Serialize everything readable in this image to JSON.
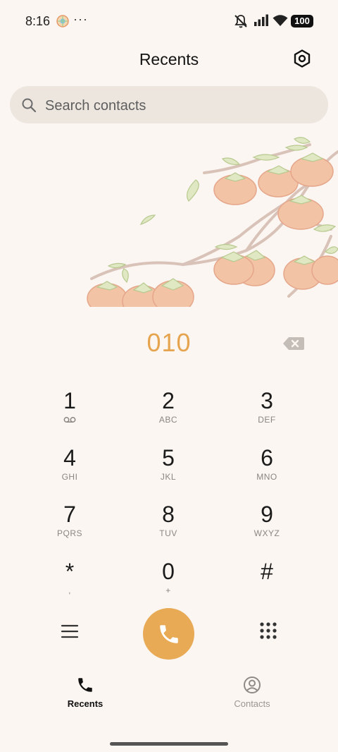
{
  "status_bar": {
    "time": "8:16",
    "more": "···",
    "battery": "100",
    "icons": [
      "app-notification-icon",
      "mute-icon",
      "signal-icon",
      "wifi-icon",
      "battery-icon"
    ]
  },
  "header": {
    "title": "Recents",
    "settings_icon": "hexagon-gear-icon"
  },
  "search": {
    "placeholder": "Search contacts",
    "value": ""
  },
  "dialer": {
    "number": "010",
    "accent_color": "#e6a44f"
  },
  "keypad": {
    "keys": [
      {
        "digit": "1",
        "letters": "voicemail"
      },
      {
        "digit": "2",
        "letters": "ABC"
      },
      {
        "digit": "3",
        "letters": "DEF"
      },
      {
        "digit": "4",
        "letters": "GHI"
      },
      {
        "digit": "5",
        "letters": "JKL"
      },
      {
        "digit": "6",
        "letters": "MNO"
      },
      {
        "digit": "7",
        "letters": "PQRS"
      },
      {
        "digit": "8",
        "letters": "TUV"
      },
      {
        "digit": "9",
        "letters": "WXYZ"
      },
      {
        "digit": "*",
        "letters": ","
      },
      {
        "digit": "0",
        "letters": "+"
      },
      {
        "digit": "#",
        "letters": ""
      }
    ]
  },
  "actions": {
    "menu_icon": "menu-icon",
    "call_icon": "phone-icon",
    "call_color": "#e8aa55",
    "keypad_icon": "dialpad-icon"
  },
  "tabs": [
    {
      "label": "Recents",
      "icon": "phone-icon",
      "active": true
    },
    {
      "label": "Contacts",
      "icon": "person-icon",
      "active": false
    }
  ]
}
